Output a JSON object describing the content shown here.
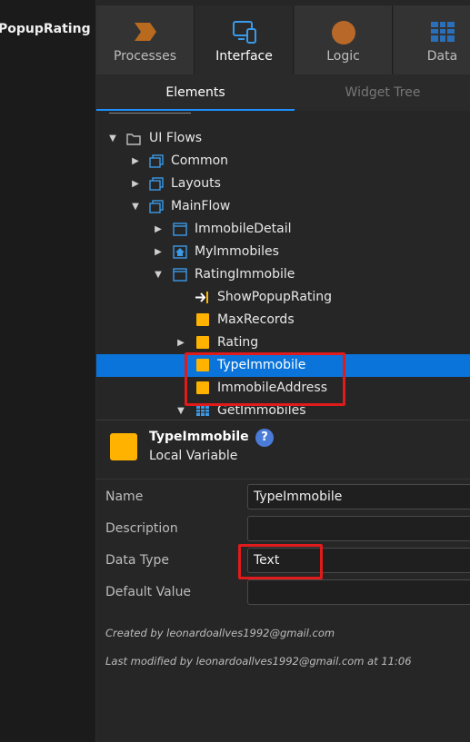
{
  "left_panel": {
    "title": "PopupRating"
  },
  "tabs": [
    {
      "label": "Processes",
      "icon": "processes-icon",
      "color": "#e8912d"
    },
    {
      "label": "Interface",
      "icon": "interface-icon",
      "color": "#3a9ae8"
    },
    {
      "label": "Logic",
      "icon": "logic-icon",
      "color": "#d3772c"
    },
    {
      "label": "Data",
      "icon": "data-icon",
      "color": "#3a9ae8"
    }
  ],
  "subtabs": {
    "elements": "Elements",
    "widget_tree": "Widget Tree"
  },
  "tree": [
    {
      "label": "UI Flows",
      "icon": "folder-icon",
      "arrow": "expanded"
    },
    {
      "label": "Common",
      "icon": "flow-icon",
      "arrow": "collapsed"
    },
    {
      "label": "Layouts",
      "icon": "flow-icon",
      "arrow": "collapsed"
    },
    {
      "label": "MainFlow",
      "icon": "flow-icon",
      "arrow": "expanded"
    },
    {
      "label": "ImmobileDetail",
      "icon": "screen-icon",
      "arrow": "collapsed"
    },
    {
      "label": "MyImmobiles",
      "icon": "home-screen-icon",
      "arrow": "collapsed"
    },
    {
      "label": "RatingImmobile",
      "icon": "screen-icon",
      "arrow": "expanded"
    },
    {
      "label": "ShowPopupRating",
      "icon": "input-parameter-icon",
      "arrow": ""
    },
    {
      "label": "MaxRecords",
      "icon": "local-variable-icon",
      "arrow": ""
    },
    {
      "label": "Rating",
      "icon": "local-variable-icon",
      "arrow": "collapsed"
    },
    {
      "label": "TypeImmobile",
      "icon": "local-variable-icon",
      "arrow": "",
      "selected": true
    },
    {
      "label": "ImmobileAddress",
      "icon": "local-variable-icon",
      "arrow": ""
    },
    {
      "label": "GetImmobiles",
      "icon": "aggregate-icon",
      "arrow": "expanded"
    }
  ],
  "detail": {
    "name": "TypeImmobile",
    "type": "Local Variable",
    "help": "?",
    "props": {
      "name_label": "Name",
      "name_value": "TypeImmobile",
      "description_label": "Description",
      "description_value": "",
      "datatype_label": "Data Type",
      "datatype_value": "Text",
      "default_label": "Default Value",
      "default_value": ""
    },
    "created_by": "Created by leonardoallves1992@gmail.com",
    "modified_by": "Last modified by leonardoallves1992@gmail.com at 11:06"
  },
  "colors": {
    "selection": "#0a74da",
    "highlight_box": "#e01b1b",
    "variable": "#ffb300",
    "accent": "#1e90ff"
  }
}
